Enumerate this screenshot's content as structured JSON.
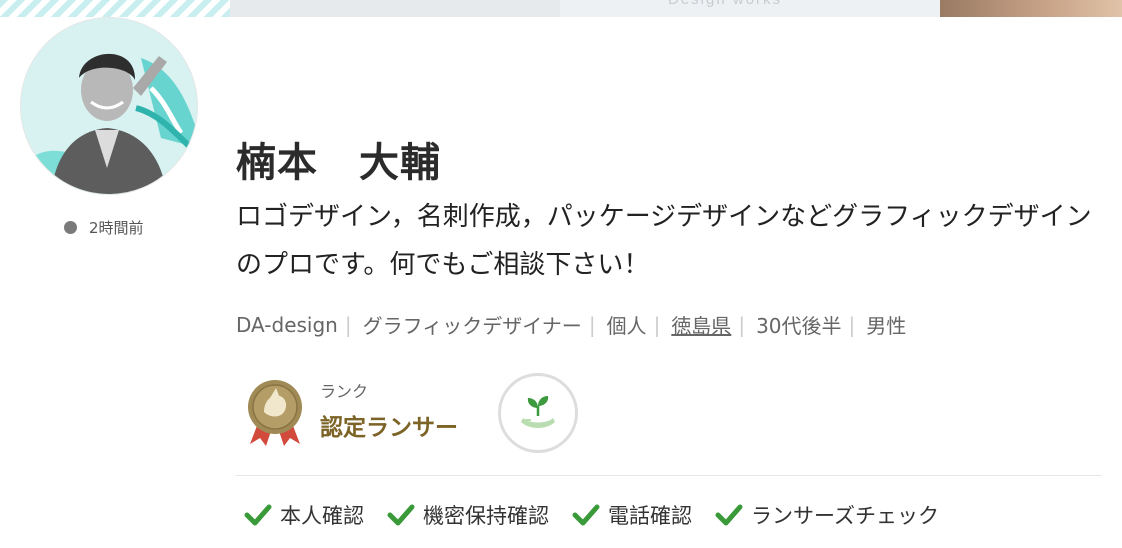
{
  "profile": {
    "name": "楠本　大輔",
    "last_login": "2時間前",
    "catchphrase": "ロゴデザイン，名刺作成，パッケージデザインなどグラフィックデザインのプロです。何でもご相談下さい！"
  },
  "meta": {
    "company": "DA-design",
    "occupation": "グラフィックデザイナー",
    "type": "個人",
    "prefecture": "徳島県",
    "age": "30代後半",
    "gender": "男性"
  },
  "rank": {
    "label": "ランク",
    "value": "認定ランサー"
  },
  "verifications": [
    {
      "label": "本人確認"
    },
    {
      "label": "機密保持確認"
    },
    {
      "label": "電話確認"
    },
    {
      "label": "ランサーズチェック"
    }
  ],
  "banner": {
    "mark": "Design works"
  },
  "colors": {
    "check": "#3a9a3a",
    "rank_text": "#7c6326",
    "online_dot": "#7a7a7a",
    "medal_gold": "#a08a55",
    "ribbon": "#d24a3c"
  }
}
